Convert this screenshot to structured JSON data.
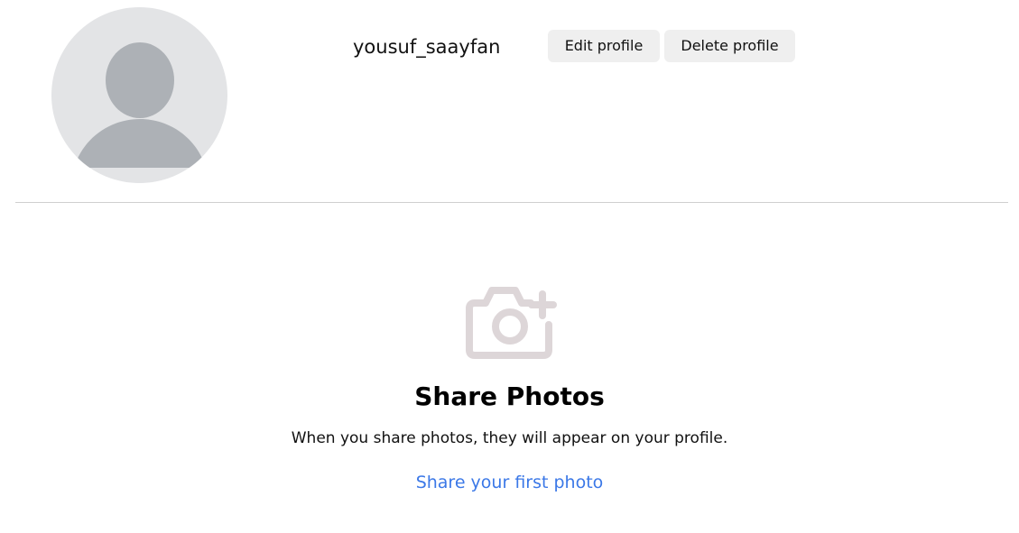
{
  "profile": {
    "username": "yousuf_saayfan",
    "edit_label": "Edit profile",
    "delete_label": "Delete profile",
    "avatar_icon": "default-user-avatar"
  },
  "empty_state": {
    "icon": "camera-plus-icon",
    "title": "Share Photos",
    "text": "When you share photos, they will appear on your profile.",
    "link_label": "Share your first photo"
  },
  "colors": {
    "button_bg": "#efefef",
    "link": "#3b78e7",
    "avatar_bg": "#e3e4e6",
    "avatar_figure": "#adb1b6",
    "camera_icon": "#ddd6d8",
    "divider": "#cfcfcf"
  }
}
